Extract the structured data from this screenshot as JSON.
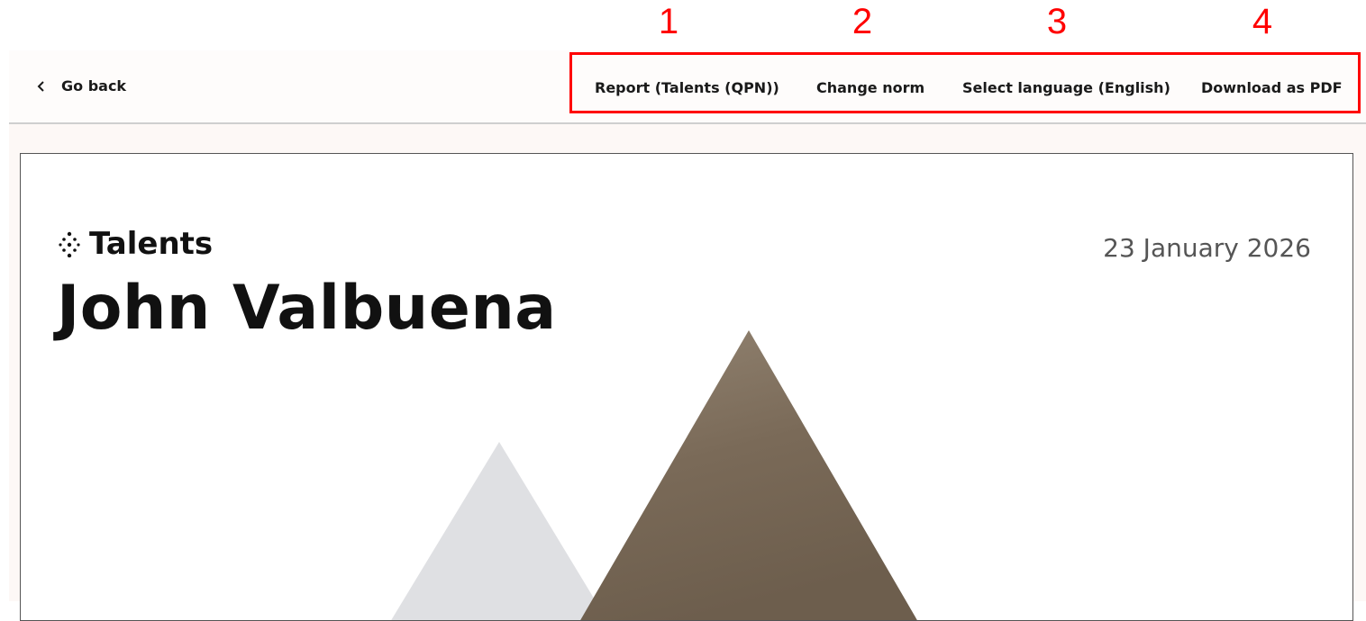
{
  "annotations": [
    "1",
    "2",
    "3",
    "4"
  ],
  "topbar": {
    "back_label": "Go back",
    "menu": [
      {
        "label": "Report (Talents (QPN))"
      },
      {
        "label": "Change norm"
      },
      {
        "label": "Select language (English)"
      },
      {
        "label": "Download as PDF"
      }
    ]
  },
  "report": {
    "brand": "Talents",
    "person_name": "John Valbuena",
    "date": "23 January 2026"
  },
  "colors": {
    "annotation": "#ff0000",
    "topbar_bg": "#fefcfb",
    "content_bg": "#fdf8f6",
    "triangle_light": "#dfe0e3",
    "triangle_photo": "#8a7a68"
  },
  "icons": {
    "back": "chevron-left-icon",
    "brand": "dots-cluster-icon"
  }
}
